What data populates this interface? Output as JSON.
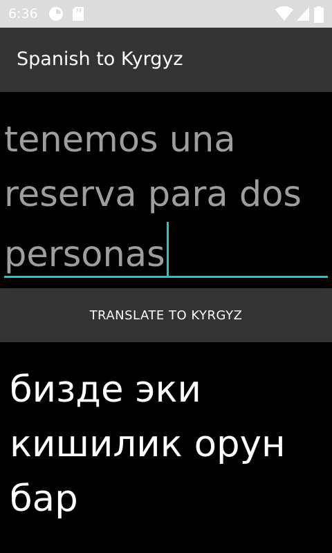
{
  "status_bar": {
    "time": "6:36",
    "left_icons": [
      "sync-icon",
      "sd-card-icon"
    ],
    "right_icons": [
      "wifi-icon",
      "signal-icon",
      "battery-icon"
    ]
  },
  "app_bar": {
    "title": "Spanish to Kyrgyz"
  },
  "input": {
    "value": "tenemos una reserva para dos personas"
  },
  "translate_button": {
    "label": "TRANSLATE TO KYRGYZ"
  },
  "output": {
    "text": "бизде эки кишилик орун бар"
  },
  "colors": {
    "accent": "#26c6c6",
    "app_bar": "#333333",
    "status_bar": "#dcdcdc",
    "background": "#000000"
  }
}
